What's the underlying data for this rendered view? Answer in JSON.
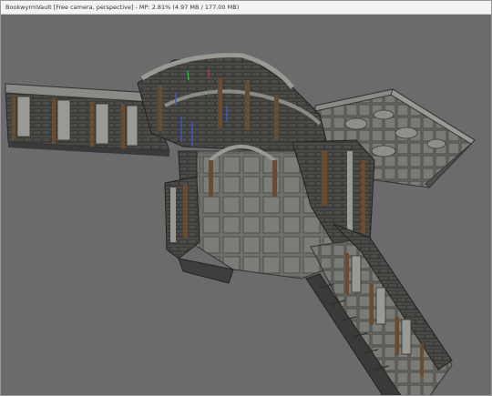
{
  "window": {
    "title": "BookwyrmVault [Free camera, perspective] - MP: 2.81% (4.97 MB / 177.00 MB)"
  },
  "viewport": {
    "background": "#6b6b6b",
    "content": "3d-dungeon-level-model"
  },
  "colors": {
    "stone_dark": "#3a3a3a",
    "stone_mid": "#5a5a58",
    "stone_light": "#8a8a86",
    "wood": "#6b4a2e",
    "marker": "#3b5bd6"
  }
}
